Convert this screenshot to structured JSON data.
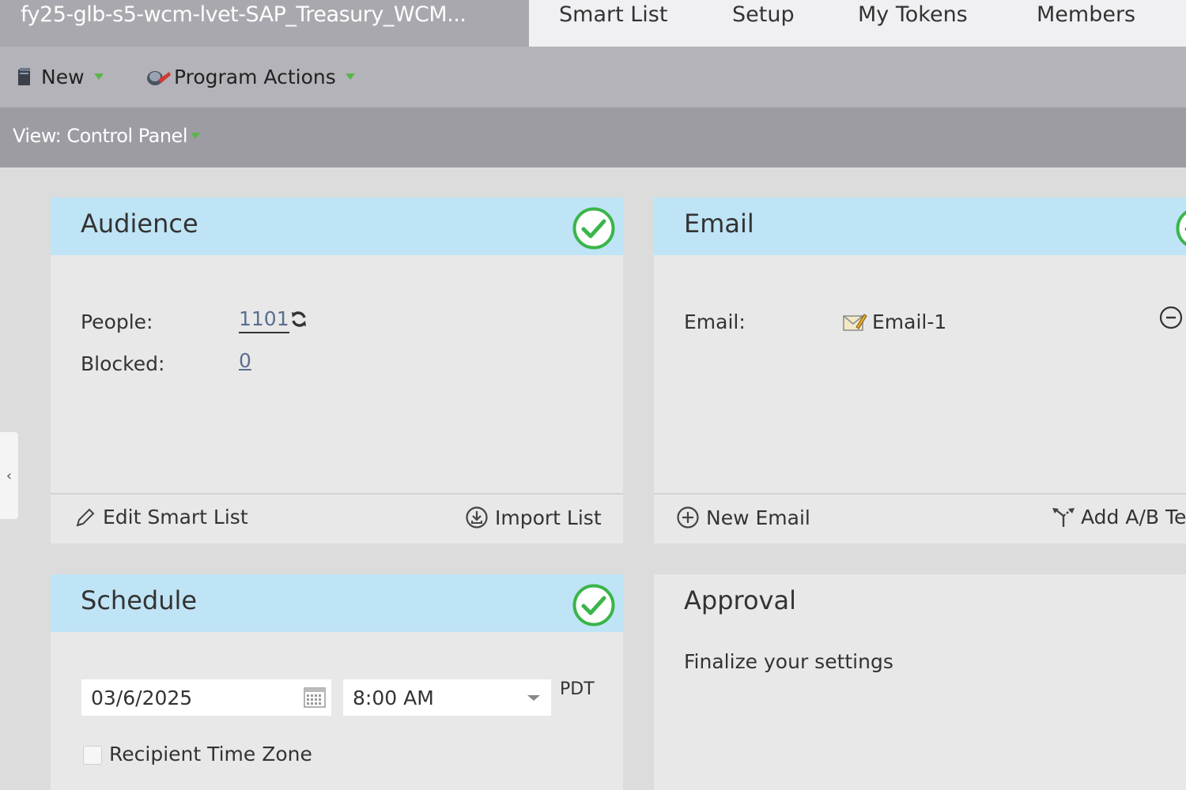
{
  "tabs": {
    "program_name": "fy25-glb-s5-wcm-lvet-SAP_Treasury_WCM...",
    "items": [
      "Smart List",
      "Setup",
      "My Tokens",
      "Members"
    ]
  },
  "toolbar": {
    "new_label": "New",
    "program_actions_label": "Program Actions"
  },
  "view": {
    "label": "View: Control Panel"
  },
  "audience": {
    "title": "Audience",
    "people_label": "People:",
    "people_value": "1101",
    "blocked_label": "Blocked:",
    "blocked_value": "0",
    "edit_smart_list": "Edit Smart List",
    "import_list": "Import List"
  },
  "email": {
    "title": "Email",
    "email_label": "Email:",
    "email_value": "Email-1",
    "new_email": "New Email",
    "add_ab_test": "Add A/B Tes"
  },
  "schedule": {
    "title": "Schedule",
    "date_value": "03/6/2025",
    "time_value": "8:00 AM",
    "timezone": "PDT",
    "recipient_time_zone": "Recipient Time Zone"
  },
  "approval": {
    "title": "Approval",
    "message": "Finalize your settings"
  },
  "colors": {
    "panel_header": "#bfe4f5",
    "check_green": "#3ab54a",
    "link": "#5a6f8f"
  }
}
